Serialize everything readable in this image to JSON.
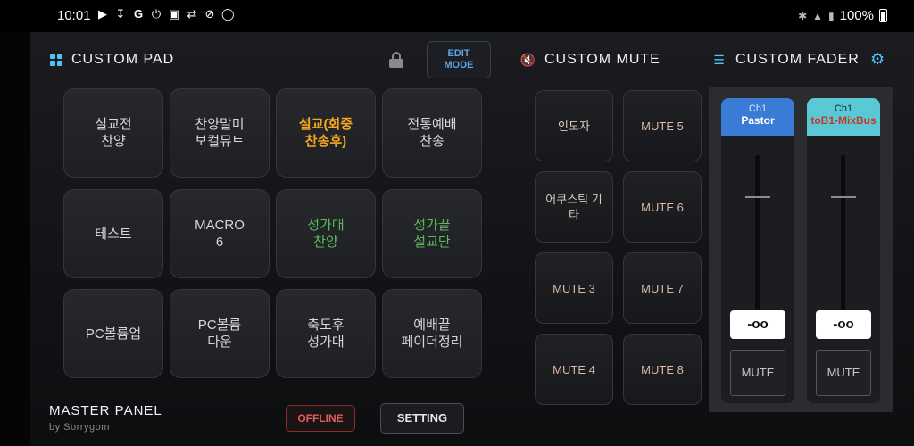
{
  "status": {
    "time": "10:01",
    "left_icons": [
      "youtube-icon",
      "download-icon",
      "google-icon",
      "power-icon",
      "tv-icon",
      "usb-icon",
      "no-sim-icon",
      "mouse-icon"
    ],
    "battery_text": "100%"
  },
  "custom_pad": {
    "title": "CUSTOM PAD",
    "edit_label_line1": "EDIT",
    "edit_label_line2": "MODE",
    "pads": [
      {
        "label": "설교전\n찬양",
        "style": "normal"
      },
      {
        "label": "찬양말미\n보컬뮤트",
        "style": "normal"
      },
      {
        "label": "설교(회중\n찬송후)",
        "style": "orange"
      },
      {
        "label": "전통예배\n찬송",
        "style": "normal"
      },
      {
        "label": "테스트",
        "style": "normal"
      },
      {
        "label": "MACRO\n6",
        "style": "normal"
      },
      {
        "label": "성가대\n찬양",
        "style": "green"
      },
      {
        "label": "성가끝\n설교단",
        "style": "green"
      },
      {
        "label": "PC볼륨업",
        "style": "normal"
      },
      {
        "label": "PC볼륨\n다운",
        "style": "normal"
      },
      {
        "label": "축도후\n성가대",
        "style": "normal"
      },
      {
        "label": "예배끝\n페이더정리",
        "style": "normal"
      }
    ]
  },
  "custom_mute": {
    "title": "CUSTOM MUTE",
    "buttons": [
      "인도자",
      "MUTE 5",
      "어쿠스틱 기타",
      "MUTE 6",
      "MUTE 3",
      "MUTE 7",
      "MUTE 4",
      "MUTE 8"
    ]
  },
  "custom_fader": {
    "title": "CUSTOM FADER",
    "channels": [
      {
        "num": "Ch1",
        "name": "Pastor",
        "head_color": "#3a7bd5",
        "name_color": "#ffffff",
        "level": "-oo",
        "mute_label": "MUTE"
      },
      {
        "num": "Ch1",
        "name": "toB1-MixBus",
        "head_color": "#5bc8d6",
        "name_color": "#c0392b",
        "level": "-oo",
        "mute_label": "MUTE"
      }
    ]
  },
  "footer": {
    "title": "MASTER PANEL",
    "subtitle": "by Sorrygom",
    "offline_label": "OFFLINE",
    "setting_label": "SETTING"
  },
  "colors": {
    "accent": "#4fc3f7",
    "orange": "#f5a623",
    "green": "#5cb85c",
    "offline_red": "#e35b5b"
  }
}
